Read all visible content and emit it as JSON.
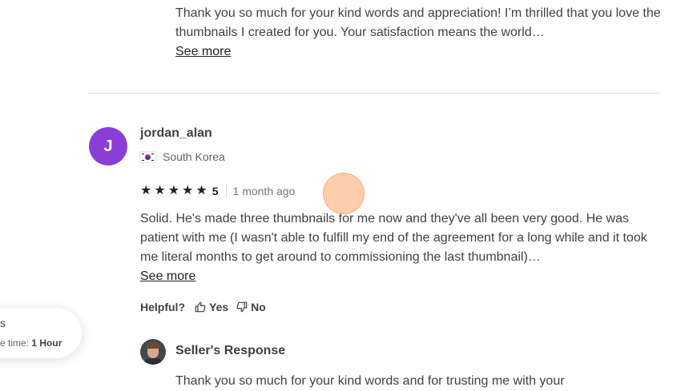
{
  "previous_response": {
    "text": "Thank you so much for your kind words and appreciation! I’m thrilled that you love the thumbnails I created for you. Your satisfaction means the world…",
    "see_more": "See more"
  },
  "review": {
    "avatar_initial": "J",
    "avatar_color": "#8a3ed6",
    "username": "jordan_alan",
    "country": "South Korea",
    "rating": "5",
    "time_ago": "1 month ago",
    "text": "Solid. He's made three thumbnails for me now and they've all been very good. He was patient with me (I wasn't able to fulfill my end of the agreement for a long while and it took me literal months to get around to commissioning the last thumbnail)…",
    "see_more": "See more",
    "helpful_label": "Helpful?",
    "yes_label": "Yes",
    "no_label": "No"
  },
  "seller_response": {
    "label": "Seller's Response",
    "text": "Thank you so much for your kind words and for trusting me with your"
  },
  "chat_widget": {
    "title": "s",
    "response_label": "e time:",
    "response_value": "1 Hour"
  },
  "icons": {
    "star": "star-icon",
    "thumbs_up": "thumbs-up-icon",
    "thumbs_down": "thumbs-down-icon",
    "flag": "south-korea-flag-icon"
  }
}
